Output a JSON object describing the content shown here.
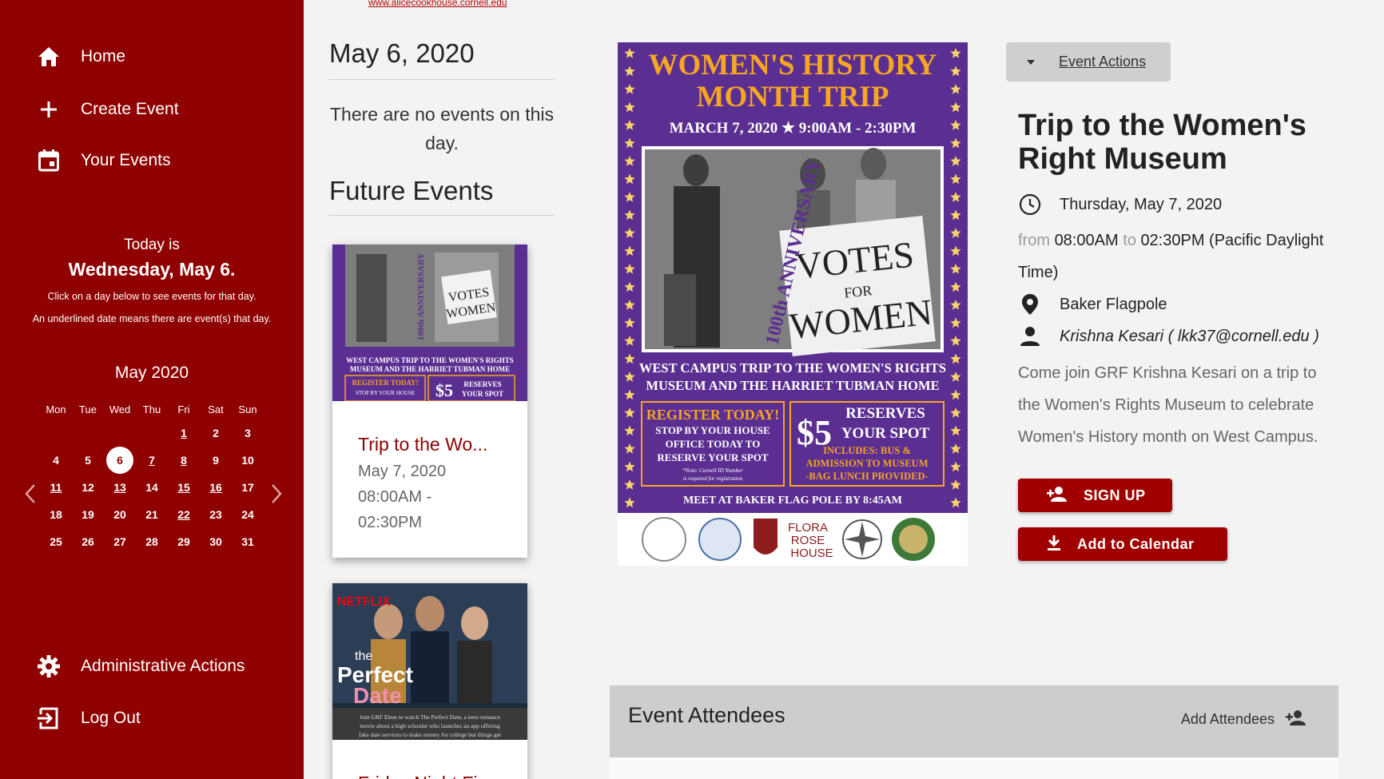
{
  "sidebar": {
    "nav": [
      {
        "label": "Home",
        "icon": "home-icon"
      },
      {
        "label": "Create Event",
        "icon": "plus-icon"
      },
      {
        "label": "Your Events",
        "icon": "calendar-icon"
      }
    ],
    "today_label": "Today is",
    "today_date": "Wednesday, May 6.",
    "hint1": "Click on a day below to see events for that day.",
    "hint2": "An underlined date means there are event(s) that day.",
    "admin_label": "Administrative Actions",
    "logout_label": "Log Out",
    "bg_color": "#8f0000"
  },
  "calendar": {
    "month": "May 2020",
    "weekdays": [
      "Mon",
      "Tue",
      "Wed",
      "Thu",
      "Fri",
      "Sat",
      "Sun"
    ],
    "weeks": [
      [
        "",
        "",
        "",
        "",
        "1",
        "2",
        "3"
      ],
      [
        "4",
        "5",
        "6",
        "7",
        "8",
        "9",
        "10"
      ],
      [
        "11",
        "12",
        "13",
        "14",
        "15",
        "16",
        "17"
      ],
      [
        "18",
        "19",
        "20",
        "21",
        "22",
        "23",
        "24"
      ],
      [
        "25",
        "26",
        "27",
        "28",
        "29",
        "30",
        "31"
      ]
    ],
    "underlined": [
      "1",
      "7",
      "8",
      "11",
      "13",
      "15",
      "16",
      "22"
    ],
    "today": "6"
  },
  "main": {
    "top_link": "www.alicecookhouse.cornell.edu",
    "date_heading": "May 6, 2020",
    "no_events": "There are no events on this day.",
    "future_heading": "Future Events",
    "cards": [
      {
        "title": "Trip to the Wo...",
        "date": "May 7, 2020",
        "time_start": "08:00AM -",
        "time_end": "02:30PM"
      },
      {
        "title": "Friday Night Fi..."
      }
    ]
  },
  "poster": {
    "title1": "WOMEN'S HISTORY",
    "title2": "MONTH TRIP",
    "date_line": "MARCH 7, 2020 ★ 9:00AM - 2:30PM",
    "anniv": "100th ANNIVERSARY",
    "sign1": "VOTES",
    "sign2": "FOR",
    "sign3": "WOMEN",
    "campus1": "WEST CAMPUS TRIP TO THE WOMEN'S RIGHTS",
    "campus2": "MUSEUM AND THE HARRIET TUBMAN HOME",
    "register": "REGISTER TODAY!",
    "stop1": "STOP BY YOUR HOUSE",
    "stop2": "OFFICE TODAY TO",
    "stop3": "RESERVE YOUR SPOT",
    "note1": "*Note: Cornell ID Number",
    "note2": "is required for registration",
    "price": "$5",
    "reserves1": "RESERVES",
    "reserves2": "YOUR SPOT",
    "includes1": "INCLUDES: BUS &",
    "includes2": "ADMISSION TO MUSEUM",
    "includes3": "-BAG LUNCH PROVIDED-",
    "meet": "MEET AT BAKER FLAG POLE BY 8:45AM",
    "flora1": "FLORA",
    "flora2": "ROSE",
    "flora3": "HOUSE",
    "purple": "#5b2e91",
    "gold": "#f5a623"
  },
  "event": {
    "actions_label": "Event Actions",
    "title": "Trip to the Women's Right Museum",
    "day": "Thursday, May 7, 2020",
    "from_word": "from",
    "start": "08:00AM",
    "to_word": "to",
    "end": "02:30PM (Pacific Daylight Time)",
    "location": "Baker Flagpole",
    "host": "Krishna Kesari ( lkk37@cornell.edu )",
    "description": "Come join GRF Krishna Kesari on a trip to the Women's Rights Museum to celebrate Women's History month on West Campus.",
    "signup_label": "SIGN UP",
    "calendar_label": "Add to Calendar"
  },
  "attendees": {
    "title": "Event Attendees",
    "add_label": "Add Attendees"
  },
  "netflix": {
    "brand": "NETFLIX",
    "the": "the",
    "title1": "Perfect",
    "title2": "Date",
    "blurb1": "Join GRF Ebun to watch The Perfect Date, a teen romance",
    "blurb2": "movie about a high schooler who launches an app offering",
    "blurb3": "fake date services to make money for college but things get"
  }
}
